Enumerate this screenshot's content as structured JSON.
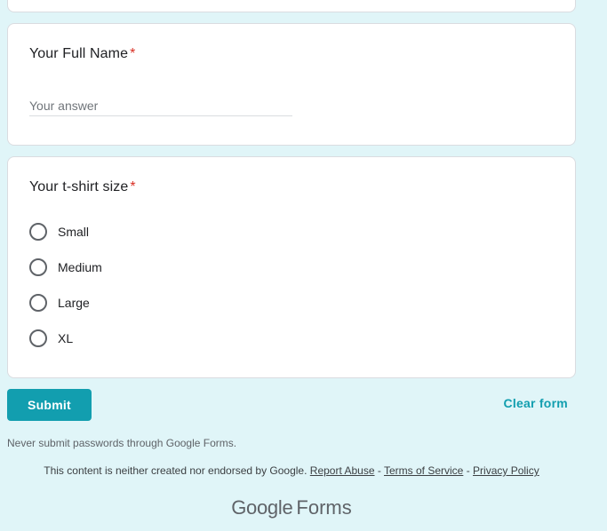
{
  "questions": {
    "full_name": {
      "label": "Your Full Name",
      "required_mark": "*",
      "placeholder": "Your answer",
      "value": ""
    },
    "tshirt_size": {
      "label": "Your t-shirt size",
      "required_mark": "*",
      "options": [
        "Small",
        "Medium",
        "Large",
        "XL"
      ],
      "selected": null
    }
  },
  "actions": {
    "submit_label": "Submit",
    "clear_label": "Clear form"
  },
  "footer": {
    "warning": "Never submit passwords through Google Forms.",
    "disclaimer": "This content is neither created nor endorsed by Google.",
    "report_abuse": "Report Abuse",
    "separator": "-",
    "terms": "Terms of Service",
    "privacy": "Privacy Policy",
    "logo_google": "Google",
    "logo_forms": "Forms"
  },
  "colors": {
    "background": "#e0f5f8",
    "accent": "#129eaf",
    "required": "#d93025"
  }
}
